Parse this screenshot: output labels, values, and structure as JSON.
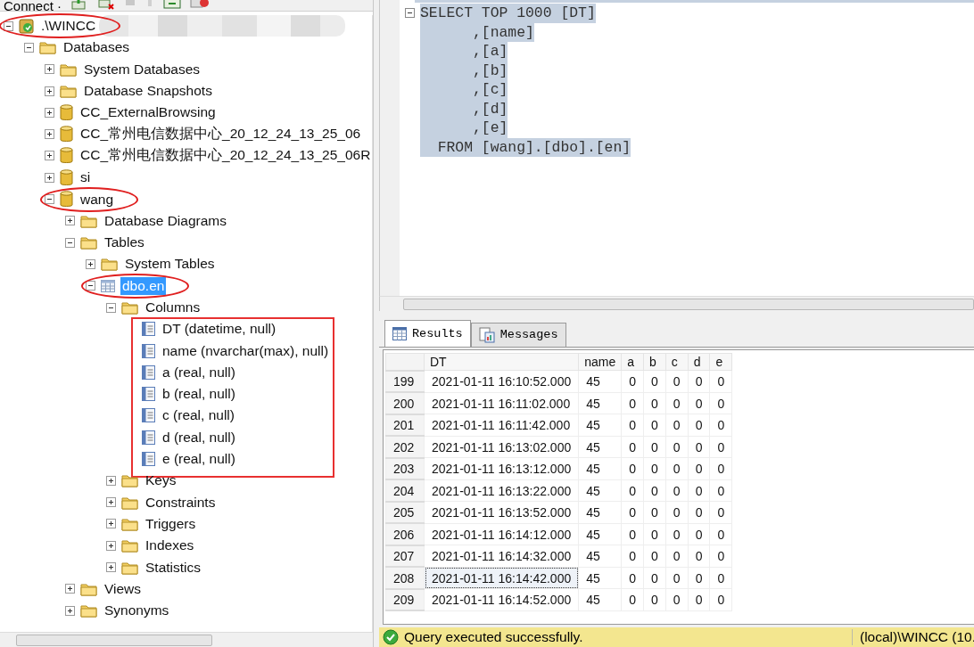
{
  "toolbar": {
    "connect_label": "Connect ·"
  },
  "tree": {
    "label": ".\\WINCC",
    "redacted": true,
    "expanded": true,
    "circled": true,
    "children": [
      {
        "label": "Databases",
        "kind": "folder",
        "expanded": true,
        "selected": false,
        "circled": false,
        "boxed": false,
        "children": [
          {
            "label": "System Databases",
            "kind": "folder",
            "expanded": false,
            "selected": false,
            "circled": false,
            "boxed": false
          },
          {
            "label": "Database Snapshots",
            "kind": "folder",
            "expanded": false,
            "selected": false,
            "circled": false,
            "boxed": false
          },
          {
            "label": "CC_ExternalBrowsing",
            "kind": "database",
            "expanded": false,
            "selected": false,
            "circled": false,
            "boxed": false
          },
          {
            "label": "CC_常州电信数据中心_20_12_24_13_25_06",
            "kind": "database",
            "expanded": false,
            "selected": false,
            "circled": false,
            "boxed": false
          },
          {
            "label": "CC_常州电信数据中心_20_12_24_13_25_06R",
            "kind": "database",
            "expanded": false,
            "selected": false,
            "circled": false,
            "boxed": false
          },
          {
            "label": "si",
            "kind": "database",
            "expanded": false,
            "selected": false,
            "circled": false,
            "boxed": false
          },
          {
            "label": "wang",
            "kind": "database",
            "expanded": true,
            "selected": false,
            "circled": true,
            "boxed": false,
            "children": [
              {
                "label": "Database Diagrams",
                "kind": "folder",
                "expanded": false,
                "selected": false,
                "circled": false,
                "boxed": false
              },
              {
                "label": "Tables",
                "kind": "folder",
                "expanded": true,
                "selected": false,
                "circled": false,
                "boxed": false,
                "children": [
                  {
                    "label": "System Tables",
                    "kind": "folder",
                    "expanded": false,
                    "selected": false,
                    "circled": false,
                    "boxed": false
                  },
                  {
                    "label": "dbo.en",
                    "kind": "table",
                    "expanded": true,
                    "selected": true,
                    "circled": true,
                    "boxed": false,
                    "children": [
                      {
                        "label": "Columns",
                        "kind": "folder",
                        "expanded": true,
                        "selected": false,
                        "circled": false,
                        "boxed": true,
                        "children": [
                          {
                            "label": "DT (datetime, null)",
                            "kind": "column",
                            "selected": false,
                            "circled": false
                          },
                          {
                            "label": "name (nvarchar(max), null)",
                            "kind": "column",
                            "selected": false,
                            "circled": false
                          },
                          {
                            "label": "a (real, null)",
                            "kind": "column",
                            "selected": false,
                            "circled": false
                          },
                          {
                            "label": "b (real, null)",
                            "kind": "column",
                            "selected": false,
                            "circled": false
                          },
                          {
                            "label": "c (real, null)",
                            "kind": "column",
                            "selected": false,
                            "circled": false
                          },
                          {
                            "label": "d (real, null)",
                            "kind": "column",
                            "selected": false,
                            "circled": false
                          },
                          {
                            "label": "e (real, null)",
                            "kind": "column",
                            "selected": false,
                            "circled": false
                          }
                        ]
                      },
                      {
                        "label": "Keys",
                        "kind": "folder",
                        "expanded": false,
                        "selected": false,
                        "circled": false,
                        "boxed": false
                      },
                      {
                        "label": "Constraints",
                        "kind": "folder",
                        "expanded": false,
                        "selected": false,
                        "circled": false,
                        "boxed": false
                      },
                      {
                        "label": "Triggers",
                        "kind": "folder",
                        "expanded": false,
                        "selected": false,
                        "circled": false,
                        "boxed": false
                      },
                      {
                        "label": "Indexes",
                        "kind": "folder",
                        "expanded": false,
                        "selected": false,
                        "circled": false,
                        "boxed": false
                      },
                      {
                        "label": "Statistics",
                        "kind": "folder",
                        "expanded": false,
                        "selected": false,
                        "circled": false,
                        "boxed": false
                      }
                    ]
                  }
                ]
              },
              {
                "label": "Views",
                "kind": "folder",
                "expanded": false,
                "selected": false,
                "circled": false,
                "boxed": false
              },
              {
                "label": "Synonyms",
                "kind": "folder",
                "expanded": false,
                "selected": false,
                "circled": false,
                "boxed": false
              }
            ]
          }
        ]
      }
    ]
  },
  "editor": {
    "lines": [
      {
        "text": "SELECT TOP 1000 [DT]",
        "selected": true
      },
      {
        "text": "      ,[name]",
        "selected": true
      },
      {
        "text": "      ,[a]",
        "selected": true
      },
      {
        "text": "      ,[b]",
        "selected": true
      },
      {
        "text": "      ,[c]",
        "selected": true
      },
      {
        "text": "      ,[d]",
        "selected": true
      },
      {
        "text": "      ,[e]",
        "selected": true
      },
      {
        "text": "  FROM [wang].[dbo].[en]",
        "selected": true
      }
    ]
  },
  "result_tabs": [
    {
      "label": "Results",
      "kind": "grid",
      "selected": true
    },
    {
      "label": "Messages",
      "kind": "messages",
      "selected": false
    }
  ],
  "results": {
    "columns": [
      "DT",
      "name",
      "a",
      "b",
      "c",
      "d",
      "e"
    ],
    "rows": [
      {
        "number": "199",
        "cells": [
          "2021-01-11 16:10:52.000",
          "45",
          "0",
          "0",
          "0",
          "0",
          "0"
        ],
        "focused": false
      },
      {
        "number": "200",
        "cells": [
          "2021-01-11 16:11:02.000",
          "45",
          "0",
          "0",
          "0",
          "0",
          "0"
        ],
        "focused": false
      },
      {
        "number": "201",
        "cells": [
          "2021-01-11 16:11:42.000",
          "45",
          "0",
          "0",
          "0",
          "0",
          "0"
        ],
        "focused": false
      },
      {
        "number": "202",
        "cells": [
          "2021-01-11 16:13:02.000",
          "45",
          "0",
          "0",
          "0",
          "0",
          "0"
        ],
        "focused": false
      },
      {
        "number": "203",
        "cells": [
          "2021-01-11 16:13:12.000",
          "45",
          "0",
          "0",
          "0",
          "0",
          "0"
        ],
        "focused": false
      },
      {
        "number": "204",
        "cells": [
          "2021-01-11 16:13:22.000",
          "45",
          "0",
          "0",
          "0",
          "0",
          "0"
        ],
        "focused": false
      },
      {
        "number": "205",
        "cells": [
          "2021-01-11 16:13:52.000",
          "45",
          "0",
          "0",
          "0",
          "0",
          "0"
        ],
        "focused": false
      },
      {
        "number": "206",
        "cells": [
          "2021-01-11 16:14:12.000",
          "45",
          "0",
          "0",
          "0",
          "0",
          "0"
        ],
        "focused": false
      },
      {
        "number": "207",
        "cells": [
          "2021-01-11 16:14:32.000",
          "45",
          "0",
          "0",
          "0",
          "0",
          "0"
        ],
        "focused": false
      },
      {
        "number": "208",
        "cells": [
          "2021-01-11 16:14:42.000",
          "45",
          "0",
          "0",
          "0",
          "0",
          "0"
        ],
        "focused": true
      },
      {
        "number": "209",
        "cells": [
          "2021-01-11 16:14:52.000",
          "45",
          "0",
          "0",
          "0",
          "0",
          "0"
        ],
        "focused": false
      }
    ]
  },
  "status_bar": {
    "message": "Query executed successfully.",
    "connection": "(local)\\WINCC (10."
  }
}
